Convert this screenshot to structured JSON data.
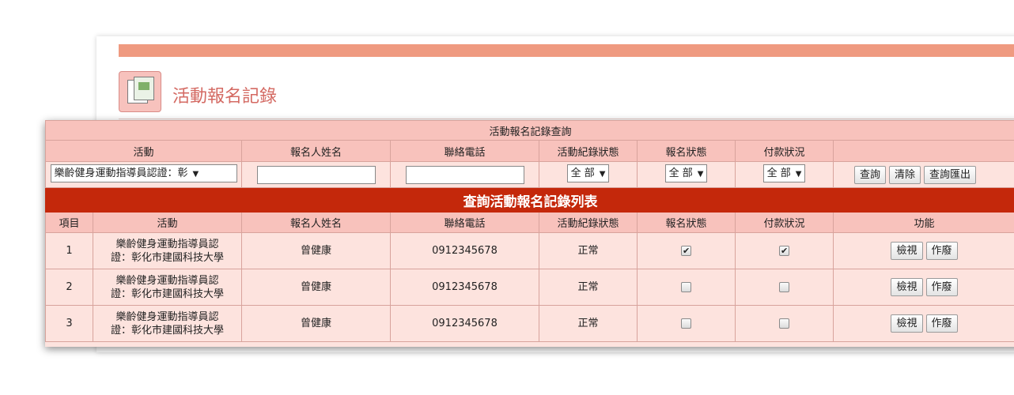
{
  "page": {
    "title": "活動報名記錄"
  },
  "query": {
    "title": "活動報名記錄查詢",
    "headers": [
      "活動",
      "報名人姓名",
      "聯絡電話",
      "活動紀錄狀態",
      "報名狀態",
      "付款狀況",
      ""
    ],
    "activity_select": "樂齡健身運動指導員認證：彰",
    "name_value": "",
    "phone_value": "",
    "record_status_select": "全 部",
    "signup_status_select": "全 部",
    "payment_status_select": "全 部",
    "buttons": {
      "search": "查詢",
      "clear": "清除",
      "export": "查詢匯出"
    }
  },
  "list": {
    "title": "查詢活動報名記錄列表",
    "headers": [
      "項目",
      "活動",
      "報名人姓名",
      "聯絡電話",
      "活動紀錄狀態",
      "報名狀態",
      "付款狀況",
      "功能"
    ],
    "rows": [
      {
        "no": "1",
        "activity_line1": "樂齡健身運動指導員認",
        "activity_line2": "證：彰化市建國科技大學",
        "name": "曾健康",
        "phone": "0912345678",
        "status": "正常",
        "signup_checked": true,
        "paid_checked": true
      },
      {
        "no": "2",
        "activity_line1": "樂齡健身運動指導員認",
        "activity_line2": "證：彰化市建國科技大學",
        "name": "曾健康",
        "phone": "0912345678",
        "status": "正常",
        "signup_checked": false,
        "paid_checked": false
      },
      {
        "no": "3",
        "activity_line1": "樂齡健身運動指導員認",
        "activity_line2": "證：彰化市建國科技大學",
        "name": "曾健康",
        "phone": "0912345678",
        "status": "正常",
        "signup_checked": false,
        "paid_checked": false
      }
    ],
    "row_buttons": {
      "view": "檢視",
      "void": "作廢"
    }
  },
  "colors": {
    "banner": "#c4280b",
    "header_bg": "#f8c2bc",
    "row_bg": "#fde3de",
    "top_bar": "#ef9a80",
    "title_text": "#d46a63"
  },
  "icons": {
    "page_icon": "document-icon",
    "dropdown": "dropdown-arrow-icon",
    "check": "checkbox-icon"
  }
}
